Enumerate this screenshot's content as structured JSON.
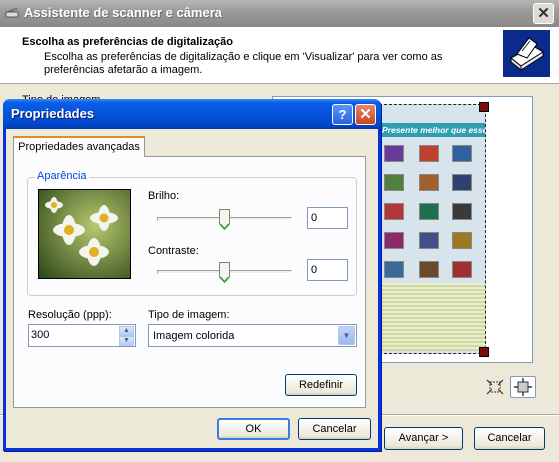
{
  "wizard": {
    "title": "Assistente de scanner e câmera",
    "close_label": "✕",
    "header_title": "Escolha as preferências de digitalização",
    "header_subtitle": "Escolha as preferências de digitalização e clique em 'Visualizar' para ver como as preferências afetarão a imagem.",
    "hidden_label": "Tipo de imagem",
    "scan_banner": "Presente melhor que esse",
    "next_button": "Avançar >",
    "cancel_button": "Cancelar"
  },
  "dialog": {
    "title": "Propriedades",
    "help_label": "?",
    "close_label": "✕",
    "tab": "Propriedades avançadas",
    "group": "Aparência",
    "brightness_label": "Brilho:",
    "brightness_value": "0",
    "brightness_level": 0.5,
    "contrast_label": "Contraste:",
    "contrast_value": "0",
    "contrast_level": 0.5,
    "resolution_label": "Resolução (ppp):",
    "resolution_value": "300",
    "image_type_label": "Tipo de imagem:",
    "image_type_value": "Imagem colorida",
    "reset_button": "Redefinir",
    "ok_button": "OK",
    "cancel_button": "Cancelar"
  },
  "colors": {
    "dialog_titlebar": "#0553d9",
    "tab_accent": "#e68b2c",
    "group_label": "#0046d5"
  }
}
